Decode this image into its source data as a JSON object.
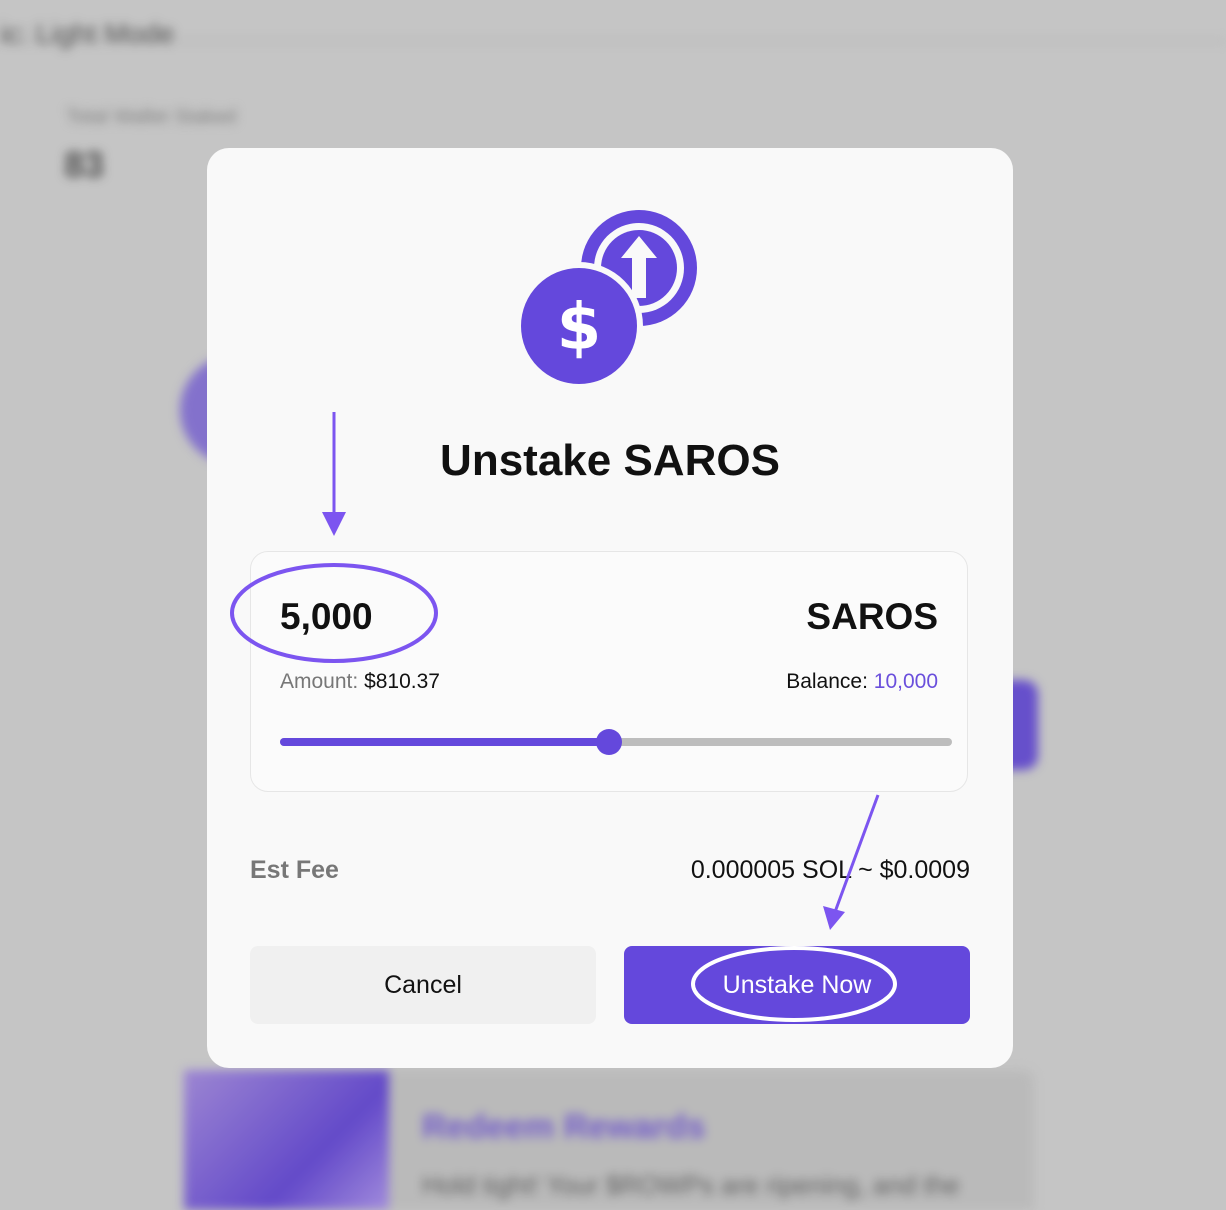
{
  "background": {
    "topbar_text": "ic: Light Mode",
    "stat_label": "Total Wallet Staked",
    "stat_value": "83",
    "card_title": "Redeem Rewards",
    "card_text": "Hold tight! Your $ROWPs are ripening, and the"
  },
  "modal": {
    "icon": "unstake-coin-icon",
    "title": "Unstake SAROS",
    "amount_value": "5,000",
    "token_symbol": "SAROS",
    "amount_label": "Amount:",
    "amount_usd": "$810.37",
    "balance_label": "Balance:",
    "balance_value": "10,000",
    "slider_fraction": 0.49,
    "fee_label": "Est Fee",
    "fee_value": "0.000005 SOL ~ $0.0009",
    "cancel_label": "Cancel",
    "confirm_label": "Unstake Now"
  },
  "colors": {
    "accent": "#6448dc",
    "annotation": "#7c55f0"
  }
}
